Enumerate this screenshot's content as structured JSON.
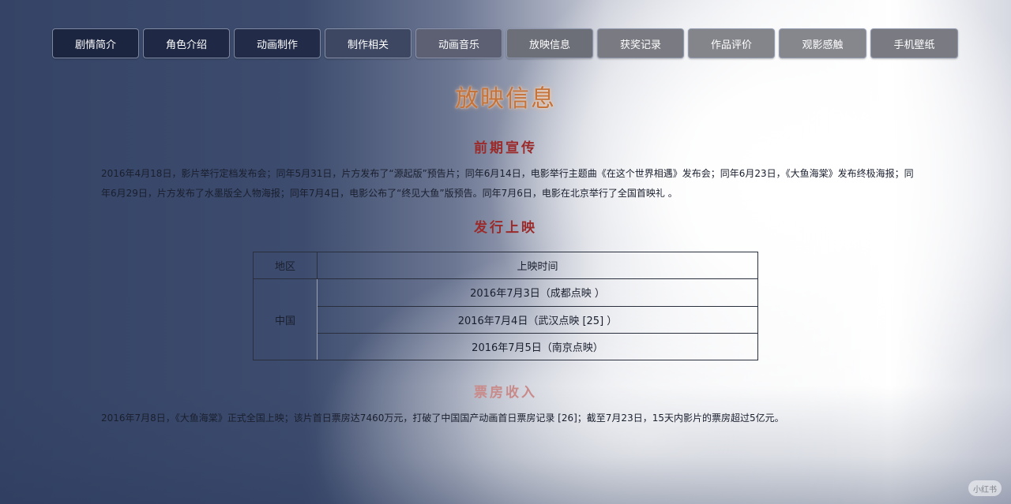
{
  "nav": {
    "items": [
      {
        "label": "剧情简介"
      },
      {
        "label": "角色介绍"
      },
      {
        "label": "动画制作"
      },
      {
        "label": "制作相关"
      },
      {
        "label": "动画音乐"
      },
      {
        "label": "放映信息"
      },
      {
        "label": "获奖记录"
      },
      {
        "label": "作品评价"
      },
      {
        "label": "观影感触"
      },
      {
        "label": "手机壁纸"
      }
    ]
  },
  "page_title": "放映信息",
  "sections": {
    "promotion": {
      "heading": "前期宣传",
      "text": "2016年4月18日，影片举行定档发布会；同年5月31日，片方发布了“源起版”预告片；同年6月14日，电影举行主题曲《在这个世界相遇》发布会；同年6月23日，《大鱼海棠》发布终极海报；同年6月29日，片方发布了水墨版全人物海报；同年7月4日，电影公布了“终见大鱼”版预告。同年7月6日，电影在北京举行了全国首映礼 。"
    },
    "release": {
      "heading": "发行上映",
      "table": {
        "headers": {
          "region": "地区",
          "date": "上映时间"
        },
        "region": "中国",
        "dates": [
          "2016年7月3日（成都点映 ）",
          "2016年7月4日（武汉点映 [25] ）",
          "2016年7月5日（南京点映）"
        ]
      }
    },
    "box_office": {
      "heading": "票房收入",
      "text": "2016年7月8日，《大鱼海棠》正式全国上映；该片首日票房达7460万元，打破了中国国产动画首日票房记录 [26]；截至7月23日，15天内影片的票房超过5亿元。"
    }
  },
  "watermark": "小红书"
}
